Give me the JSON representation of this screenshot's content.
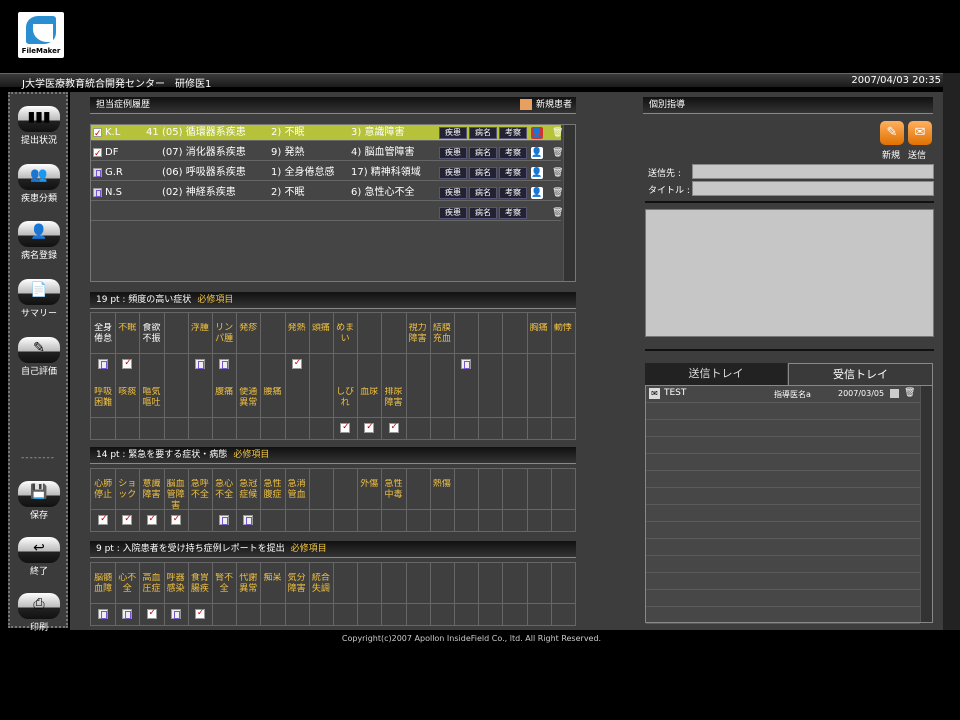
{
  "app": {
    "logo_text": "FileMaker",
    "org_title": "J大学医療教育統合開発センター　研修医1",
    "datetime": "2007/04/03 20:35"
  },
  "sidebar": {
    "items": [
      {
        "label": "提出状況",
        "icon": "bar-chart-icon",
        "glyph": "▮▮▮"
      },
      {
        "label": "疾患分類",
        "icon": "people-icon",
        "glyph": "👥"
      },
      {
        "label": "病名登録",
        "icon": "person-icon",
        "glyph": "👤"
      },
      {
        "label": "サマリー",
        "icon": "document-icon",
        "glyph": "📄"
      },
      {
        "label": "自己評価",
        "icon": "edit-icon",
        "glyph": "✎"
      }
    ],
    "separator": "--------",
    "bottom_items": [
      {
        "label": "保存",
        "icon": "save-icon",
        "glyph": "💾"
      },
      {
        "label": "終了",
        "icon": "return-icon",
        "glyph": "↩"
      },
      {
        "label": "印刷",
        "icon": "print-icon",
        "glyph": "⎙"
      }
    ]
  },
  "cases": {
    "title": "担当症例履歴",
    "new_patient_label": "新規患者",
    "buttons": [
      "疾患",
      "病名",
      "考察"
    ],
    "rows": [
      {
        "initials": "K.L",
        "age": "41",
        "category": "(05) 循環器系疾患",
        "s1": "2) 不眠",
        "s2": "3) 意識障害",
        "selected": true,
        "checked": true,
        "status": "red"
      },
      {
        "initials": "DF",
        "age": "",
        "category": "(07) 消化器系疾患",
        "s1": "9) 発熱",
        "s2": "4) 脳血管障害",
        "selected": false,
        "checked": true,
        "status": "white"
      },
      {
        "initials": "G.R",
        "age": "",
        "category": "(06) 呼吸器系疾患",
        "s1": "1) 全身倦怠感",
        "s2": "17) 精神科領域",
        "selected": false,
        "checked": false,
        "status": "white"
      },
      {
        "initials": "N.S",
        "age": "",
        "category": "(02) 神経系疾患",
        "s1": "2) 不眠",
        "s2": "6) 急性心不全",
        "selected": false,
        "checked": false,
        "status": "white"
      },
      {
        "initials": "",
        "age": "",
        "category": "",
        "s1": "",
        "s2": "",
        "selected": false,
        "checked": false,
        "status": "none"
      }
    ]
  },
  "sections": {
    "s1": {
      "title": "19 pt : 頻度の高い症状",
      "required": "必修項目",
      "row1": [
        "全身倦怠",
        "不眠",
        "食欲不振",
        "",
        "浮腫",
        "リンパ腫",
        "発疹",
        "",
        "発熱",
        "頭痛",
        "めまい",
        "",
        "",
        "視力障害",
        "結膜充血",
        "",
        "",
        "",
        "胸痛",
        "動悸"
      ],
      "row1_marks": [
        "pg",
        "on",
        "",
        "",
        "pg",
        "pg",
        "",
        "",
        "on",
        "",
        "",
        "",
        "",
        "",
        "",
        "pg",
        "",
        "",
        "",
        ""
      ],
      "row2": [
        "呼吸困難",
        "咳痰",
        "嘔気嘔吐",
        "",
        "",
        "腹痛",
        "便通異常",
        "腰痛",
        "",
        "",
        "しびれ",
        "血尿",
        "排尿障害",
        "",
        "",
        "",
        "",
        "",
        "",
        ""
      ],
      "row2_marks": [
        "",
        "",
        "",
        "",
        "",
        "",
        "",
        "",
        "",
        "",
        "on",
        "on",
        "on",
        "",
        "",
        "",
        "",
        "",
        "",
        ""
      ]
    },
    "s2": {
      "title": "14 pt : 緊急を要する症状・病態",
      "required": "必修項目",
      "row1": [
        "心肺停止",
        "ショック",
        "意識障害",
        "脳血管障害",
        "急呼不全",
        "急心不全",
        "急冠症候",
        "急性腹症",
        "急消管血",
        "",
        "",
        "外傷",
        "急性中毒",
        "",
        "熱傷",
        "",
        "",
        "",
        "",
        ""
      ],
      "row1_marks": [
        "on",
        "on",
        "on",
        "on",
        "",
        "pg",
        "pg",
        "",
        "",
        "",
        "",
        "",
        "",
        "",
        "",
        "",
        "",
        "",
        "",
        ""
      ]
    },
    "s3": {
      "title": "9 pt : 入院患者を受け持ち症例レポートを提出",
      "required": "必修項目",
      "row1": [
        "脳髄血障",
        "心不全",
        "高血圧症",
        "呼器感染",
        "食胃腸疾",
        "腎不全",
        "代謝異常",
        "痴呆",
        "気分障害",
        "統合失調",
        "",
        "",
        "",
        "",
        "",
        "",
        "",
        "",
        "",
        ""
      ],
      "row1_marks": [
        "pg",
        "pg",
        "on",
        "pg",
        "on",
        "",
        "",
        "",
        "",
        "",
        "",
        "",
        "",
        "",
        "",
        "",
        "",
        "",
        "",
        ""
      ]
    }
  },
  "message": {
    "title": "個別指導",
    "new_label": "新規",
    "send_label": "送信",
    "to_label": "送信先 :",
    "subject_label": "タイトル :",
    "to_value": "",
    "subject_value": "",
    "tabs": [
      "送信トレイ",
      "受信トレイ"
    ],
    "active_tab": 1,
    "tray_rows": [
      {
        "subject": "TEST",
        "sender": "指導医名a",
        "date": "2007/03/05"
      }
    ]
  },
  "footer": {
    "copyright": "Copyright(c)2007 Apollon InsideField Co., ltd. All Right Reserved."
  },
  "colors": {
    "selected_row": "#b5c23a",
    "required": "#f5c842",
    "accent_orange": "#e07000"
  }
}
